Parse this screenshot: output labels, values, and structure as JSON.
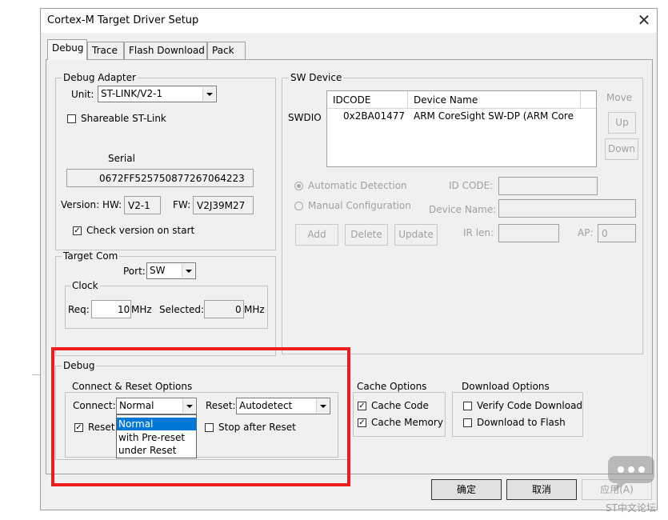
{
  "window": {
    "title": "Cortex-M Target Driver Setup",
    "close_glyph": "✕"
  },
  "tabs": [
    {
      "label": "Debug",
      "active": true
    },
    {
      "label": "Trace"
    },
    {
      "label": "Flash Download"
    },
    {
      "label": "Pack"
    }
  ],
  "debug_adapter": {
    "group_label": "Debug Adapter",
    "unit_label": "Unit:",
    "unit_value": "ST-LINK/V2-1",
    "shareable_label": "Shareable ST-Link",
    "shareable_checked": false,
    "serial_label": "Serial",
    "serial_value": "0672FF525750877267064223",
    "version_label": "Version: HW:",
    "hw_value": "V2-1",
    "fw_label": "FW:",
    "fw_value": "V2J39M27",
    "check_version_label": "Check version on start",
    "check_version_checked": true
  },
  "target_com": {
    "group_label": "Target Com",
    "port_label": "Port:",
    "port_value": "SW",
    "clock_label": "Clock",
    "req_label": "Req:",
    "req_value": "10",
    "req_unit": "MHz",
    "selected_label": "Selected:",
    "selected_value": "0",
    "selected_unit": "MHz"
  },
  "sw_device": {
    "group_label": "SW Device",
    "swdio_label": "SWDIO",
    "columns": [
      "IDCODE",
      "Device Name"
    ],
    "rows": [
      {
        "idcode": "0x2BA01477",
        "name": "ARM CoreSight SW-DP (ARM Core"
      }
    ],
    "move_label": "Move",
    "up_label": "Up",
    "down_label": "Down",
    "auto_detect_label": "Automatic Detection",
    "manual_config_label": "Manual Configuration",
    "id_code_label": "ID CODE:",
    "device_name_label": "Device Name:",
    "add_label": "Add",
    "delete_label": "Delete",
    "update_label": "Update",
    "ir_len_label": "IR len:",
    "ap_label": "AP:",
    "ap_value": "0"
  },
  "debug": {
    "group_label": "Debug",
    "connect_reset_label": "Connect & Reset Options",
    "connect_label": "Connect:",
    "connect_value": "Normal",
    "connect_options": [
      "Normal",
      "with Pre-reset",
      "under Reset"
    ],
    "reset_label": "Reset:",
    "reset_value": "Autodetect",
    "reset_after_connect_label": "Reset",
    "reset_after_connect_checked": true,
    "stop_after_reset_label": "Stop after Reset",
    "stop_after_reset_checked": false
  },
  "cache_options": {
    "group_label": "Cache Options",
    "cache_code_label": "Cache Code",
    "cache_code_checked": true,
    "cache_memory_label": "Cache Memory",
    "cache_memory_checked": true
  },
  "download_options": {
    "group_label": "Download Options",
    "verify_label": "Verify Code Download",
    "verify_checked": false,
    "flash_label": "Download to Flash",
    "flash_checked": false
  },
  "buttons": {
    "ok": "确定",
    "cancel": "取消",
    "apply": "应用(A)"
  },
  "watermark": "ST中文论坛",
  "colors": {
    "highlight_box": "#ee1c1c",
    "selection": "#0078d7"
  }
}
